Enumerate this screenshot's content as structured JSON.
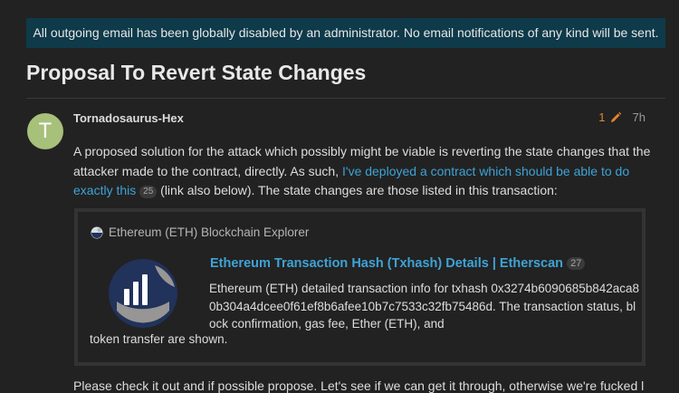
{
  "banner": {
    "text": "All outgoing email has been globally disabled by an administrator. No email notifications of any kind will be sent."
  },
  "topic": {
    "title": "Proposal To Revert State Changes"
  },
  "post": {
    "avatar_letter": "T",
    "avatar_color": "#a7c07a",
    "username": "Tornadosaurus-Hex",
    "edit_count": "1",
    "date": "7h",
    "body_part1": "A proposed solution for the attack which possibly might be viable is reverting the state changes that the attacker made to the contract, directly. As such, ",
    "body_link": "I've deployed a contract which should be able to do exactly this",
    "body_link_clicks": "25",
    "body_part2": " (link also below). The state changes are those listed in this transaction:",
    "next_paragraph": "Please check it out and if possible propose. Let's see if we can get it through, otherwise we're fucked l"
  },
  "onebox": {
    "source": "Ethereum (ETH) Blockchain Explorer",
    "title": "Ethereum Transaction Hash (Txhash) Details | Etherscan",
    "title_clicks": "27",
    "description": "Ethereum (ETH) detailed transaction info for txhash 0x3274b6090685b842aca80b304a4dcee0f61ef8b6afee10b7c7533c32fb75486d. The transaction status, block confirmation, gas fee, Ether (ETH), and",
    "description_tail": "token transfer are shown."
  },
  "colors": {
    "background": "#222222",
    "banner": "#0e3a4a",
    "link": "#3ea3d6",
    "edit_orange": "#e5862d"
  },
  "icons": {
    "edit": "pencil-icon",
    "favicon": "etherscan-favicon",
    "thumbnail": "etherscan-logo"
  }
}
